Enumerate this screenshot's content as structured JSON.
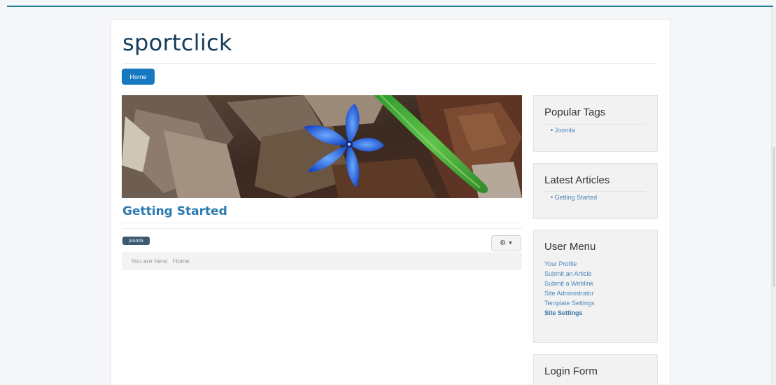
{
  "site": {
    "title": "sportclick"
  },
  "nav": {
    "items": [
      {
        "label": "Home"
      }
    ]
  },
  "article": {
    "title": "Getting Started",
    "tag": "joomla",
    "tools_icon": "gear-icon"
  },
  "breadcrumb": {
    "prefix": "You are here:",
    "current": "Home"
  },
  "sidebar": {
    "popular_tags": {
      "title": "Popular Tags",
      "items": [
        "Joomla"
      ]
    },
    "latest_articles": {
      "title": "Latest Articles",
      "items": [
        "Getting Started"
      ]
    },
    "user_menu": {
      "title": "User Menu",
      "items": [
        "Your Profile",
        "Submit an Article",
        "Submit a Weblink",
        "Site Administrator",
        "Template Settings",
        "Site Settings"
      ]
    },
    "login_form": {
      "title": "Login Form"
    }
  },
  "colors": {
    "accent": "#1679bf",
    "title": "#163d59",
    "link": "#2a7ab0",
    "topline": "#1e7f9a"
  }
}
